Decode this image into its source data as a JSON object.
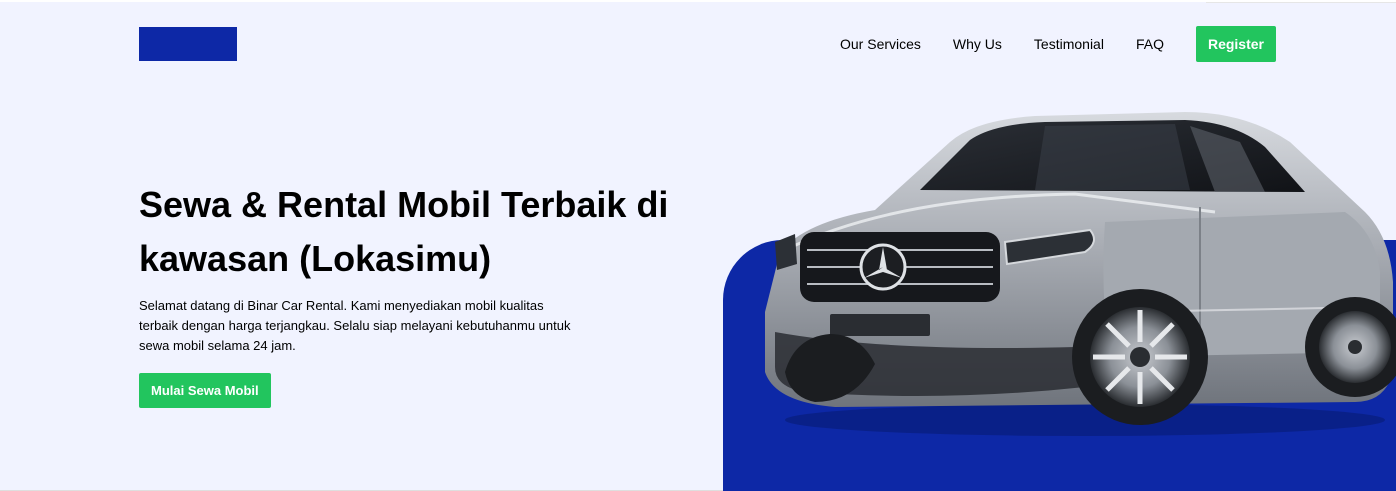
{
  "nav": {
    "links": [
      {
        "label": "Our Services"
      },
      {
        "label": "Why Us"
      },
      {
        "label": "Testimonial"
      },
      {
        "label": "FAQ"
      }
    ],
    "register_label": "Register"
  },
  "hero": {
    "headline": "Sewa & Rental Mobil Terbaik di kawasan (Lokasimu)",
    "description": "Selamat datang di Binar Car Rental. Kami menyediakan mobil kualitas terbaik dengan harga terjangkau. Selalu siap melayani kebutuhanmu untuk sewa mobil selama 24 jam.",
    "cta_label": "Mulai Sewa Mobil"
  },
  "colors": {
    "brand_blue": "#0d28a6",
    "accent_green": "#22c55e",
    "background": "#f1f3ff"
  },
  "icons": {
    "logo": "logo-block",
    "car": "car-illustration"
  }
}
